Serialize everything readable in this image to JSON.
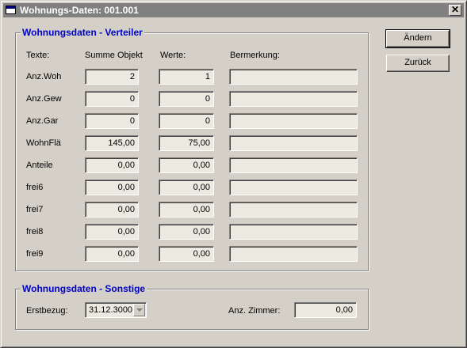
{
  "window": {
    "title": "Wohnungs-Daten: 001.001",
    "close_glyph": "✕"
  },
  "verteiler": {
    "legend": "Wohnungsdaten - Verteiler",
    "headers": {
      "texte": "Texte:",
      "summe": "Summe Objekt",
      "werte": "Werte:",
      "bemerkung": "Bermerkung:"
    },
    "rows": [
      {
        "label": "Anz.Woh",
        "summe": "2",
        "wert": "1",
        "bemerkung": ""
      },
      {
        "label": "Anz.Gew",
        "summe": "0",
        "wert": "0",
        "bemerkung": ""
      },
      {
        "label": "Anz.Gar",
        "summe": "0",
        "wert": "0",
        "bemerkung": ""
      },
      {
        "label": "WohnFlä",
        "summe": "145,00",
        "wert": "75,00",
        "bemerkung": ""
      },
      {
        "label": "Anteile",
        "summe": "0,00",
        "wert": "0,00",
        "bemerkung": ""
      },
      {
        "label": "frei6",
        "summe": "0,00",
        "wert": "0,00",
        "bemerkung": ""
      },
      {
        "label": "frei7",
        "summe": "0,00",
        "wert": "0,00",
        "bemerkung": ""
      },
      {
        "label": "frei8",
        "summe": "0,00",
        "wert": "0,00",
        "bemerkung": ""
      },
      {
        "label": "frei9",
        "summe": "0,00",
        "wert": "0,00",
        "bemerkung": ""
      }
    ]
  },
  "sonstige": {
    "legend": "Wohnungsdaten - Sonstige",
    "erstbezug_label": "Erstbezug:",
    "erstbezug_value": "31.12.3000",
    "zimmer_label": "Anz. Zimmer:",
    "zimmer_value": "0,00"
  },
  "buttons": {
    "aendern": "Ändern",
    "zurueck": "Zurück"
  },
  "colors": {
    "face": "#d4d0c8",
    "titlebar_inactive": "#808080",
    "legend": "#0000c8",
    "field_bg": "#ece9e1"
  },
  "icons": {
    "app": "window-icon",
    "close": "close-icon",
    "combo": "chevron-down-icon"
  }
}
